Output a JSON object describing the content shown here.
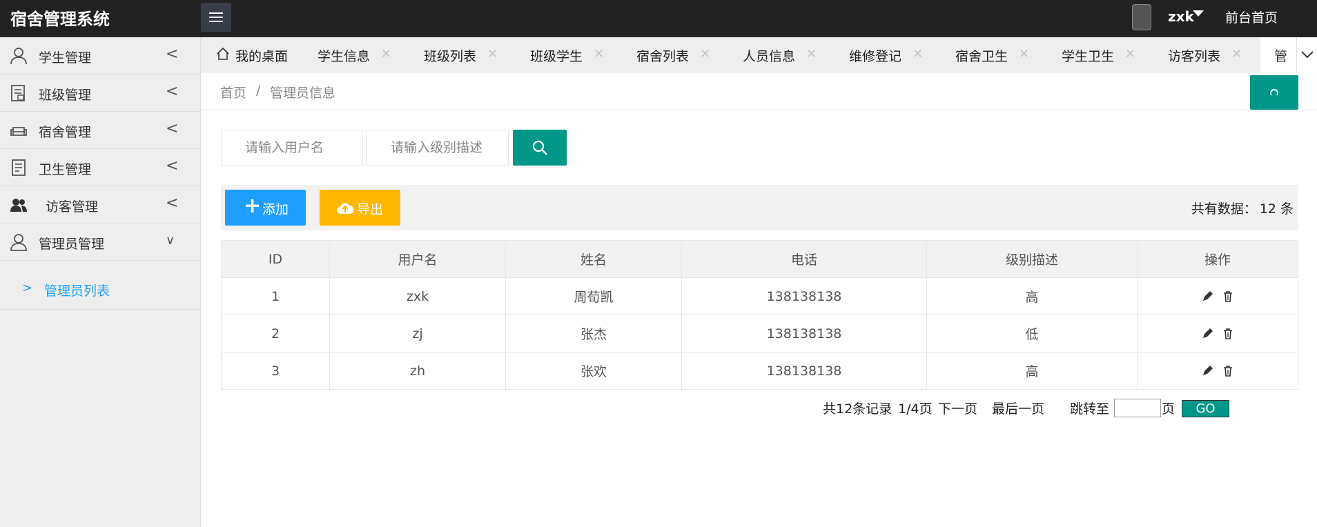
{
  "app": {
    "title": "宿舍管理系统"
  },
  "header": {
    "user_name": "zxk",
    "front_link": "前台首页"
  },
  "sidebar": {
    "items": [
      {
        "label": "学生管理",
        "arrow": "<"
      },
      {
        "label": "班级管理",
        "arrow": "<"
      },
      {
        "label": "宿舍管理",
        "arrow": "<"
      },
      {
        "label": "卫生管理",
        "arrow": "<"
      },
      {
        "label": "访客管理",
        "arrow": "<"
      },
      {
        "label": "管理员管理",
        "arrow": "∨"
      }
    ],
    "sub_item": {
      "chevron": ">",
      "label": "管理员列表"
    }
  },
  "tabs": {
    "home": "我的桌面",
    "items": [
      "学生信息",
      "班级列表",
      "班级学生",
      "宿舍列表",
      "人员信息",
      "维修登记",
      "宿舍卫生",
      "学生卫生",
      "访客列表"
    ],
    "close_glyph": "×",
    "active_partial": "管"
  },
  "breadcrumb": {
    "home": "首页",
    "separator": "/",
    "current": "管理员信息"
  },
  "search": {
    "username_placeholder": "请输入用户名",
    "level_placeholder": "请输入级别描述"
  },
  "toolbar": {
    "add_label": "添加",
    "export_label": "导出",
    "total_label": "共有数据：",
    "total_count": "12 条"
  },
  "table": {
    "headers": [
      "ID",
      "用户名",
      "姓名",
      "电话",
      "级别描述",
      "操作"
    ],
    "rows": [
      [
        "1",
        "zxk",
        "周荀凯",
        "138138138",
        "高"
      ],
      [
        "2",
        "zj",
        "张杰",
        "138138138",
        "低"
      ],
      [
        "3",
        "zh",
        "张欢",
        "138138138",
        "高"
      ]
    ]
  },
  "pagination": {
    "records": "共12条记录",
    "page": "1/4页",
    "next": "下一页",
    "last": "最后一页",
    "jump_label": "跳转至",
    "page_unit": "页",
    "go": "GO"
  },
  "colors": {
    "teal": "#009688",
    "blue": "#1E9FFF",
    "yellow": "#FFB800",
    "topbar": "#222222"
  }
}
